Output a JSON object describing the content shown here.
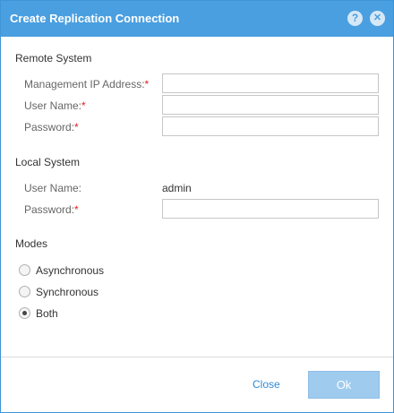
{
  "dialog": {
    "title": "Create Replication Connection",
    "help_icon": "?",
    "close_icon": "✕"
  },
  "remote": {
    "section_title": "Remote System",
    "ip_label": "Management IP Address:",
    "user_label": "User Name:",
    "password_label": "Password:",
    "ip_value": "",
    "user_value": "",
    "password_value": ""
  },
  "local": {
    "section_title": "Local System",
    "user_label": "User Name:",
    "user_value": "admin",
    "password_label": "Password:",
    "password_value": ""
  },
  "modes": {
    "section_title": "Modes",
    "options": [
      "Asynchronous",
      "Synchronous",
      "Both"
    ],
    "selected": "Both"
  },
  "required_marker": "*",
  "footer": {
    "close_label": "Close",
    "ok_label": "Ok"
  },
  "colors": {
    "titlebar": "#4a9fe0",
    "link": "#2f8ad6",
    "ok_button": "#9fcbef",
    "required": "#e02020"
  },
  "icons": {
    "help": "help-icon",
    "close": "close-icon"
  }
}
